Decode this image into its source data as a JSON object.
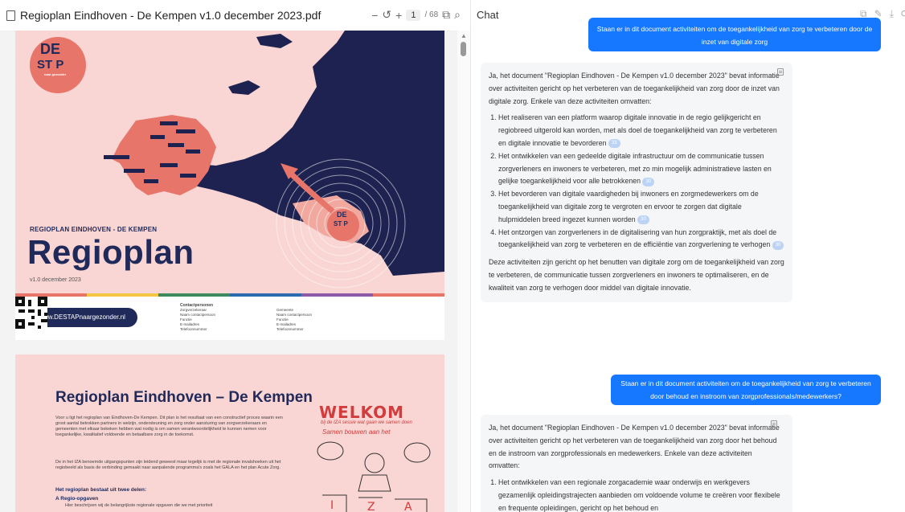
{
  "pdf": {
    "title": "Regioplan Eindhoven - De Kempen v1.0 december 2023.pdf",
    "toolbar": {
      "zoom_out": "−",
      "rotate": "↺",
      "zoom_in": "+",
      "page_current": "1",
      "page_total": "/ 68",
      "fit_icon": "⧉",
      "search_icon": "⌕"
    },
    "page1": {
      "logo_de": "DE",
      "logo_stap": "ST P",
      "logo_small": "naar gezonder",
      "subtitle": "REGIOPLAN EINDHOVEN - DE KEMPEN",
      "title": "Regioplan",
      "date": "v1.0 december 2023",
      "website": "www.DESTAPnaargezonder.nl",
      "contact_heading": "Contactpersonen",
      "contact_col1": "Zorgverzekeraar\nNaam contactpersoon\nFunctie\nE-mailadres\nTelefoonnummer",
      "contact_col2": "Gemeente\nNaam contactpersoon\nFunctie\nE-mailadres\nTelefoonnummer"
    },
    "page2": {
      "title": "Regioplan Eindhoven – De Kempen",
      "para1": "Voor u ligt het regioplan van Eindhoven-De Kempen. Dit plan is het resultaat van een constructief proces waarin een groot aantal betrokken partners in welzijn, ondersteuning en zorg onder aansturing van zorgverzekeraars en gemeenten met elkaar bekeken hebben wat nodig is om samen verantwoordelijkheid te kunnen nemen voor toegankelijke, kwalitatief voldoende en betaalbare zorg in de toekomst.",
      "para2": "De in het IZA benoemde uitgangspunten zijn leidend geweest maar tegelijk is met de regionale invalshoeken uit het regiobeeld als basis de verbinding gemaakt naar aanpalende programma's zoals het GALA en het plan Acute Zorg.",
      "heading": "Het regioplan bestaat uit twee delen:",
      "item_a": "A  Regio-opgaven",
      "item_a_text": "Hier beschrijven wij de belangrijkste regionale opgaven die we met prioriteit",
      "welkom": "WELKOM",
      "welkom_sub": "bij de IZA sessie wat gaan we samen doen",
      "welkom_sub2": "Samen bouwen aan het"
    }
  },
  "chat": {
    "title": "Chat",
    "tools": [
      "⧉",
      "✎",
      "⤓",
      "⟳"
    ],
    "messages": [
      {
        "role": "user",
        "text": "Staan er in dit document activiteiten om de toegankelijkheid van zorg te verbeteren door de inzet van digitale zorg"
      },
      {
        "role": "assistant",
        "intro": "Ja, het document \"Regioplan Eindhoven - De Kempen v1.0 december 2023\" bevat informatie over activiteiten gericht op het verbeteren van de toegankelijkheid van zorg door de inzet van digitale zorg. Enkele van deze activiteiten omvatten:",
        "items": [
          {
            "text": "Het realiseren van een platform waarop digitale innovatie in de regio gelijkgericht en regiobreed uitgerold kan worden, met als doel de toegankelijkheid van zorg te verbeteren en digitale innovatie te bevorderen",
            "cite": "33"
          },
          {
            "text": "Het ontwikkelen van een gedeelde digitale infrastructuur om de communicatie tussen zorgverleners en inwoners te verbeteren, met zo min mogelijk administratieve lasten en gelijke toegankelijkheid voor alle betrokkenen",
            "cite": "30"
          },
          {
            "text": "Het bevorderen van digitale vaardigheden bij inwoners en zorgmedewerkers om de toegankelijkheid van digitale zorg te vergroten en ervoor te zorgen dat digitale hulpmiddelen breed ingezet kunnen worden",
            "cite": "30"
          },
          {
            "text": "Het ontzorgen van zorgverleners in de digitalisering van hun zorgpraktijk, met als doel de toegankelijkheid van zorg te verbeteren en de efficiëntie van zorgverlening te verhogen",
            "cite": "30"
          }
        ],
        "outro": "Deze activiteiten zijn gericht op het benutten van digitale zorg om de toegankelijkheid van zorg te verbeteren, de communicatie tussen zorgverleners en inwoners te optimaliseren, en de kwaliteit van zorg te verhogen door middel van digitale innovatie."
      },
      {
        "role": "user",
        "text": "Staan er in dit document activiteiten om de toegankelijkheid van zorg te verbeteren door behoud en instroom van zorgprofessionals/medewerkers?"
      },
      {
        "role": "assistant",
        "intro": "Ja, het document \"Regioplan Eindhoven - De Kempen v1.0 december 2023\" bevat informatie over activiteiten gericht op het verbeteren van de toegankelijkheid van zorg door het behoud en de instroom van zorgprofessionals en medewerkers. Enkele van deze activiteiten omvatten:",
        "items": [
          {
            "text": "Het ontwikkelen van een regionale zorgacademie waar onderwijs en werkgevers gezamenlijk opleidingstrajecten aanbieden om voldoende volume te creëren voor flexibele en frequente opleidingen, gericht op het behoud en",
            "cite": ""
          }
        ]
      }
    ]
  }
}
